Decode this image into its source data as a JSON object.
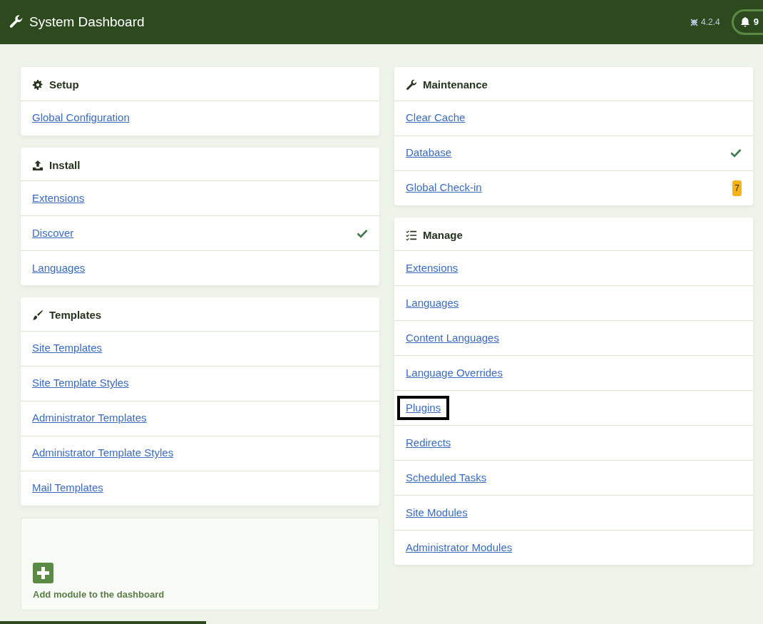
{
  "header": {
    "title": "System Dashboard",
    "version": "4.2.4",
    "notifications": "9"
  },
  "columns": [
    [
      {
        "title": "Setup",
        "items": [
          {
            "label": "Global Configuration",
            "kind": "plain",
            "highlighted": false
          }
        ]
      },
      {
        "title": "Install",
        "items": [
          {
            "label": "Extensions",
            "kind": "plain",
            "highlighted": false
          },
          {
            "label": "Discover",
            "kind": "check",
            "highlighted": false
          },
          {
            "label": "Languages",
            "kind": "plain",
            "highlighted": false
          }
        ]
      },
      {
        "title": "Templates",
        "items": [
          {
            "label": "Site Templates",
            "kind": "plain",
            "highlighted": false
          },
          {
            "label": "Site Template Styles",
            "kind": "plain",
            "highlighted": false
          },
          {
            "label": "Administrator Templates",
            "kind": "plain",
            "highlighted": false
          },
          {
            "label": "Administrator Template Styles",
            "kind": "plain",
            "highlighted": false
          },
          {
            "label": "Mail Templates",
            "kind": "plain",
            "highlighted": false
          }
        ]
      }
    ],
    [
      {
        "title": "Maintenance",
        "items": [
          {
            "label": "Clear Cache",
            "kind": "plain",
            "highlighted": false
          },
          {
            "label": "Database",
            "kind": "check",
            "highlighted": false
          },
          {
            "label": "Global Check-in",
            "kind": "count",
            "count": "7",
            "highlighted": false
          }
        ]
      },
      {
        "title": "Manage",
        "items": [
          {
            "label": "Extensions",
            "kind": "plain",
            "highlighted": false
          },
          {
            "label": "Languages",
            "kind": "plain",
            "highlighted": false
          },
          {
            "label": "Content Languages",
            "kind": "plain",
            "highlighted": false
          },
          {
            "label": "Language Overrides",
            "kind": "plain",
            "highlighted": false
          },
          {
            "label": "Plugins",
            "kind": "plain",
            "highlighted": true
          },
          {
            "label": "Redirects",
            "kind": "plain",
            "highlighted": false
          },
          {
            "label": "Scheduled Tasks",
            "kind": "plain",
            "highlighted": false
          },
          {
            "label": "Site Modules",
            "kind": "plain",
            "highlighted": false
          },
          {
            "label": "Administrator Modules",
            "kind": "plain",
            "highlighted": false
          }
        ]
      }
    ]
  ],
  "add_module": {
    "label": "Add module to the dashboard"
  },
  "loading_bar": {
    "level": 0.27
  }
}
